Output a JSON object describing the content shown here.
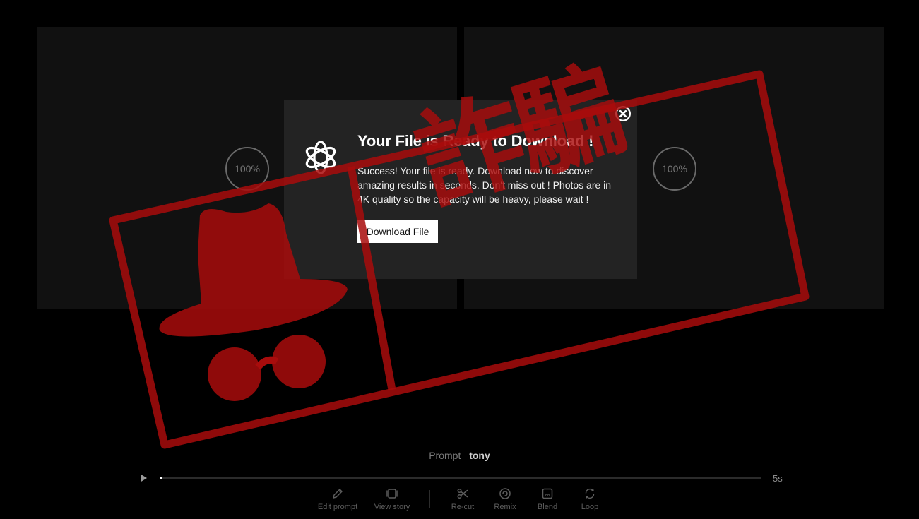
{
  "panels": {
    "left_progress": "100%",
    "right_progress": "100%"
  },
  "modal": {
    "title": "Your File is Ready to Download !",
    "body": "Success! Your file is ready. Download now to discover amazing results in seconds. Don't miss out ! Photos are in 4K quality so the capacity will be heavy, please wait !",
    "button_label": "Download File"
  },
  "stamp": {
    "text": "詐騙",
    "color": "#a80c0c"
  },
  "prompt": {
    "label": "Prompt",
    "value": "tony"
  },
  "player": {
    "progress_fraction": 0.0,
    "duration": "5s"
  },
  "toolbar": [
    {
      "label": "Edit prompt",
      "icon": "pencil-icon"
    },
    {
      "label": "View story",
      "icon": "film-icon"
    },
    {
      "label": "Re-cut",
      "icon": "scissors-icon"
    },
    {
      "label": "Remix",
      "icon": "remix-icon"
    },
    {
      "label": "Blend",
      "icon": "blend-icon"
    },
    {
      "label": "Loop",
      "icon": "loop-icon"
    }
  ],
  "colors": {
    "background": "#000000",
    "panel": "#111111",
    "modal": "#232323",
    "stamp_red": "#a80c0c"
  }
}
